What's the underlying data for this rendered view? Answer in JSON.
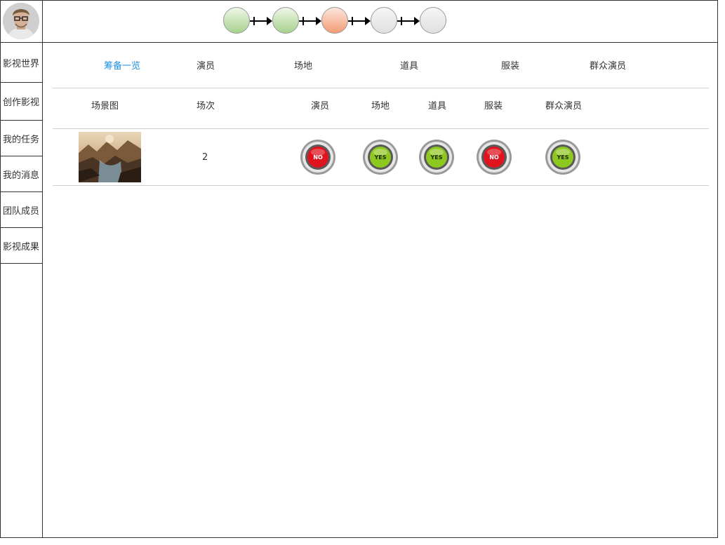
{
  "workflow_steps": [
    {
      "state": "done"
    },
    {
      "state": "done"
    },
    {
      "state": "current"
    },
    {
      "state": "todo"
    },
    {
      "state": "todo"
    }
  ],
  "sidebar": {
    "items": [
      {
        "label": "影视世界"
      },
      {
        "label": "创作影视"
      },
      {
        "label": "我的任务"
      },
      {
        "label": "我的消息"
      },
      {
        "label": "团队成员"
      },
      {
        "label": "影视成果"
      }
    ]
  },
  "tabs": [
    {
      "label": "筹备一览",
      "active": true
    },
    {
      "label": "演员"
    },
    {
      "label": "场地"
    },
    {
      "label": "道具"
    },
    {
      "label": "服装"
    },
    {
      "label": "群众演员"
    }
  ],
  "table": {
    "headers": [
      "场景图",
      "场次",
      "演员",
      "场地",
      "道具",
      "服装",
      "群众演员"
    ],
    "rows": [
      {
        "scene_number": "2",
        "statuses": [
          {
            "label": "NO",
            "color": "#e0141e"
          },
          {
            "label": "YES",
            "color": "#8cc81e"
          },
          {
            "label": "YES",
            "color": "#8cc81e"
          },
          {
            "label": "NO",
            "color": "#e0141e"
          },
          {
            "label": "YES",
            "color": "#8cc81e"
          }
        ]
      }
    ]
  },
  "colors": {
    "accent": "#1e90e8",
    "step_done": "#a6d18d",
    "step_current": "#f49a74",
    "step_todo": "#e0e0e0"
  }
}
